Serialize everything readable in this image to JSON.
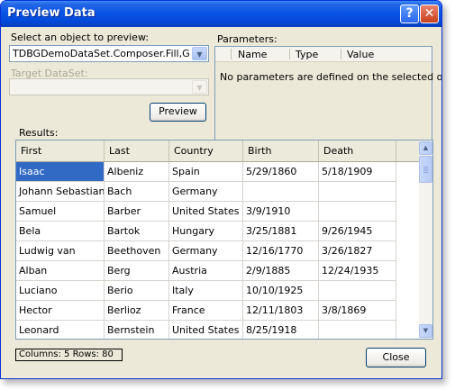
{
  "window": {
    "title": "Preview Data",
    "help_glyph": "?",
    "close_glyph": "✕"
  },
  "left": {
    "object_label": "Select an object to preview:",
    "object_value": "TDBGDemoDataSet.Composer.Fill,GetData",
    "target_label": "Target DataSet:",
    "target_value": "",
    "preview_button": "Preview"
  },
  "parameters": {
    "label": "Parameters:",
    "columns": [
      "Name",
      "Type",
      "Value"
    ],
    "empty_message": "No parameters are defined on the selected object."
  },
  "results": {
    "label": "Results:",
    "columns": [
      "First",
      "Last",
      "Country",
      "Birth",
      "Death"
    ],
    "rows": [
      [
        "Isaac",
        "Albeniz",
        "Spain",
        "5/29/1860",
        "5/18/1909"
      ],
      [
        "Johann Sebastian",
        "Bach",
        "Germany",
        "",
        ""
      ],
      [
        "Samuel",
        "Barber",
        "United States",
        "3/9/1910",
        ""
      ],
      [
        "Bela",
        "Bartok",
        "Hungary",
        "3/25/1881",
        "9/26/1945"
      ],
      [
        "Ludwig van",
        "Beethoven",
        "Germany",
        "12/16/1770",
        "3/26/1827"
      ],
      [
        "Alban",
        "Berg",
        "Austria",
        "2/9/1885",
        "12/24/1935"
      ],
      [
        "Luciano",
        "Berio",
        "Italy",
        "10/10/1925",
        ""
      ],
      [
        "Hector",
        "Berlioz",
        "France",
        "12/11/1803",
        "3/8/1869"
      ],
      [
        "Leonard",
        "Bernstein",
        "United States",
        "8/25/1918",
        ""
      ]
    ],
    "selected_row": 0,
    "selected_column": 0
  },
  "status": {
    "text": "Columns: 5    Rows: 80"
  },
  "close_button": "Close",
  "icons": {
    "dropdown": "chevron-down-icon",
    "scroll_up": "scroll-up-icon",
    "scroll_down": "scroll-down-icon"
  },
  "colors": {
    "titlebar": "#0a55e6",
    "selection": "#316ac5",
    "face": "#ece9d8"
  }
}
